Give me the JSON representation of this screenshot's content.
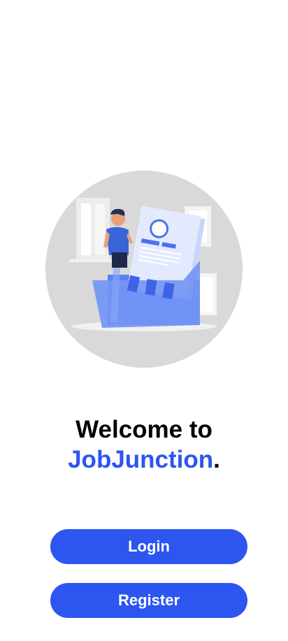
{
  "welcome": {
    "line1": "Welcome to",
    "brand": "JobJunction",
    "punctuation": "."
  },
  "buttons": {
    "login_label": "Login",
    "register_label": "Register"
  },
  "illustration": {
    "icon": "job-search-folder-illustration"
  },
  "colors": {
    "accent": "#2d55f0",
    "background": "#ffffff",
    "circle": "#d9d9d9"
  }
}
